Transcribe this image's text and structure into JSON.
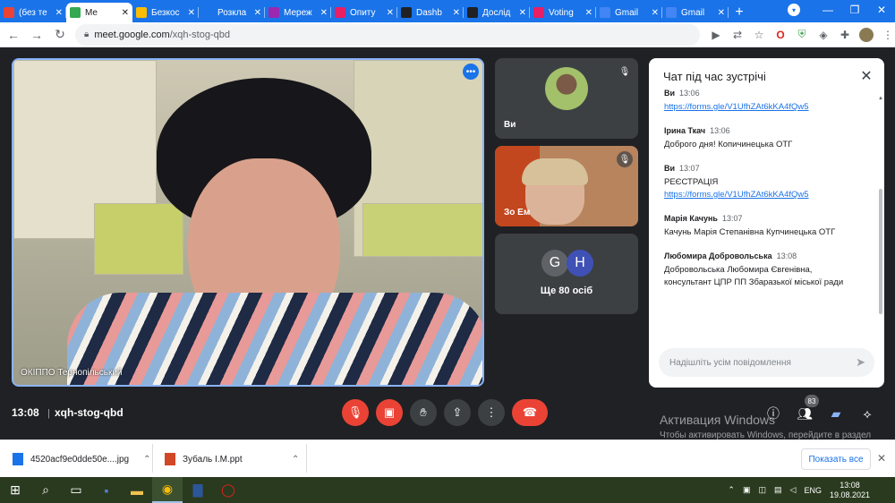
{
  "browser": {
    "tabs": [
      {
        "label": "(без те",
        "color": "#ea4335"
      },
      {
        "label": "Me",
        "color": "#34a853",
        "active": true
      },
      {
        "label": "Безкос",
        "color": "#fbbc04"
      },
      {
        "label": "Розкла",
        "color": "#1a73e8"
      },
      {
        "label": "Мереж",
        "color": "#9c27b0"
      },
      {
        "label": "Опиту",
        "color": "#e91e63"
      },
      {
        "label": "Dashb",
        "color": "#202124"
      },
      {
        "label": "Дослід",
        "color": "#202124"
      },
      {
        "label": "Voting",
        "color": "#e91e63"
      },
      {
        "label": "Gmail",
        "color": "#4285f4"
      },
      {
        "label": "Gmail",
        "color": "#4285f4"
      }
    ],
    "new_tab": "+",
    "url_host": "meet.google.com",
    "url_path": "/xqh-stog-qbd"
  },
  "meeting": {
    "main_name": "ОКІППО Тернопільський",
    "tile1_name": "Ви",
    "tile2_name": "Зо Ем",
    "more_count_label": "Ще 80 осіб",
    "avatar1": "G",
    "avatar2": "H",
    "time": "13:08",
    "separator": "|",
    "code": "xqh-stog-qbd",
    "participants_badge": "83"
  },
  "chat": {
    "title": "Чат під час зустрічі",
    "messages": [
      {
        "sender": "Ви",
        "time": "13:06",
        "lines": [],
        "link": "https://forms.gle/V1UfhZAt6kKA4fQw5"
      },
      {
        "sender": "Ірина Ткач",
        "time": "13:06",
        "lines": [
          "Доброго дня! Копичинецька ОТГ"
        ],
        "link": ""
      },
      {
        "sender": "Ви",
        "time": "13:07",
        "lines": [
          "РЕЄСТРАЦІЯ"
        ],
        "link": "https://forms.gle/V1UfhZAt6kKA4fQw5"
      },
      {
        "sender": "Марія Качунь",
        "time": "13:07",
        "lines": [
          "Качунь Марія Степанівна  Купчинецька ОТГ"
        ],
        "link": ""
      },
      {
        "sender": "Любомира Добровольська",
        "time": "13:08",
        "lines": [
          "Добровольська Любомира Євгенівна,",
          "консультант ЦПР ПП Збаразької міської ради"
        ],
        "link": ""
      }
    ],
    "input_placeholder": "Надішліть усім повідомлення"
  },
  "watermark": {
    "title": "Активация Windows",
    "text": "Чтобы активировать Windows, перейдите в раздел \"Параметры\"."
  },
  "downloads": {
    "items": [
      {
        "name": "4520acf9e0dde50e....jpg"
      },
      {
        "name": "Зубаль І.М.ppt"
      }
    ],
    "show_all": "Показать все"
  },
  "taskbar": {
    "lang": "ENG",
    "time": "13:08",
    "date": "19.08.2021"
  },
  "colors": {
    "meet_bg": "#202124",
    "accent": "#1a73e8",
    "end_call": "#ea4335"
  }
}
